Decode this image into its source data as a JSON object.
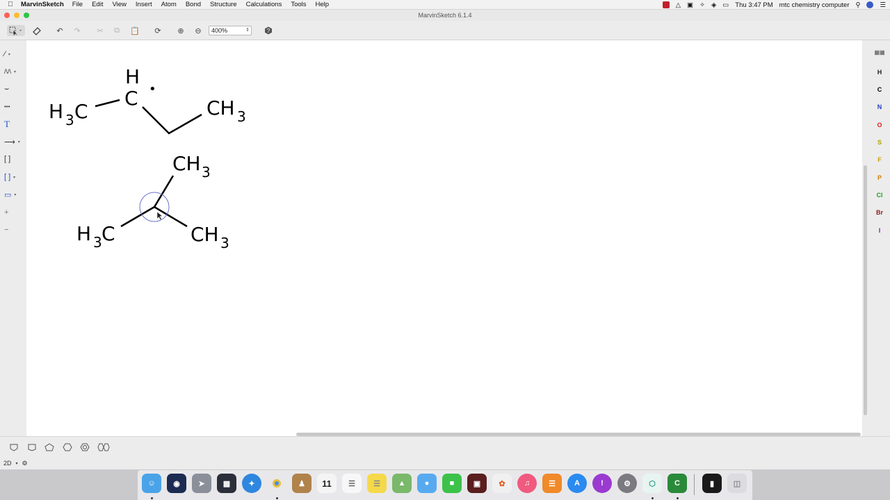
{
  "menubar": {
    "app_name": "MarvinSketch",
    "items": [
      "File",
      "Edit",
      "View",
      "Insert",
      "Atom",
      "Bond",
      "Structure",
      "Calculations",
      "Tools",
      "Help"
    ],
    "clock": "Thu 3:47 PM",
    "user": "mtc chemistry computer"
  },
  "window": {
    "title": "MarvinSketch 6.1.4"
  },
  "toolbar": {
    "zoom_value": "400%"
  },
  "left_tools": {
    "text_tool": "T",
    "plus": "+",
    "minus": "−"
  },
  "molecules": {
    "mol1": {
      "h3c": "H",
      "h3c_sub": "3",
      "h3c_c": "C",
      "center_h": "H",
      "center_c": "C",
      "radical": "•",
      "ch3": "CH",
      "ch3_sub": "3"
    },
    "mol2": {
      "top_ch3": "CH",
      "top_sub": "3",
      "left_h3c": "H",
      "left_sub": "3",
      "left_c": "C",
      "right_ch3": "CH",
      "right_sub": "3"
    }
  },
  "elements": [
    {
      "symbol": "H",
      "color": "#222222"
    },
    {
      "symbol": "C",
      "color": "#000000"
    },
    {
      "symbol": "N",
      "color": "#1f3fc8"
    },
    {
      "symbol": "O",
      "color": "#e02020"
    },
    {
      "symbol": "S",
      "color": "#b0a000"
    },
    {
      "symbol": "F",
      "color": "#c8a000"
    },
    {
      "symbol": "P",
      "color": "#d08000"
    },
    {
      "symbol": "Cl",
      "color": "#20a020"
    },
    {
      "symbol": "Br",
      "color": "#8a2020"
    },
    {
      "symbol": "I",
      "color": "#8020a0"
    }
  ],
  "statusbar": {
    "mode": "2D"
  },
  "dock": {
    "calendar_day": "11"
  }
}
